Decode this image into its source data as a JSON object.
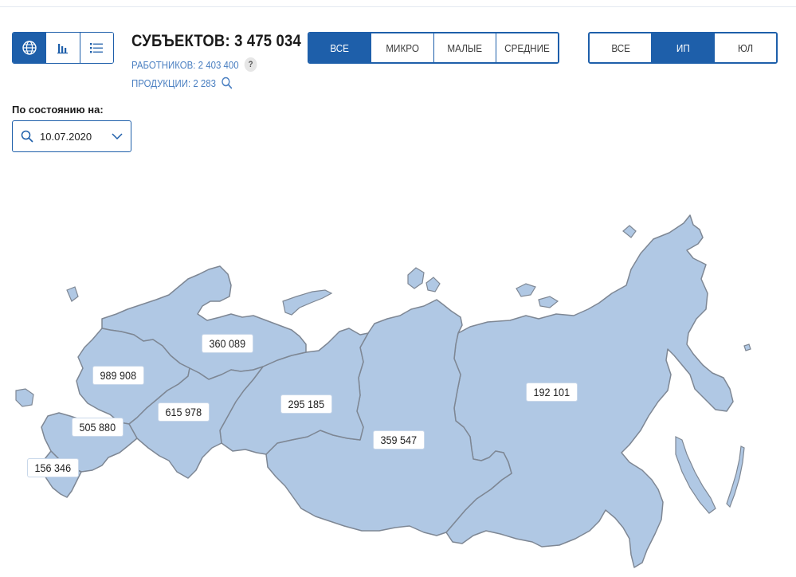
{
  "views": [
    {
      "icon": "globe-icon",
      "active": true
    },
    {
      "icon": "bar-chart-icon",
      "active": false
    },
    {
      "icon": "list-icon",
      "active": false
    }
  ],
  "totals": {
    "subjects_label": "СУБЪЕКТОВ:",
    "subjects_value": "3 475 034",
    "workers_label": "РАБОТНИКОВ:",
    "workers_value": "2 403 400",
    "products_label": "ПРОДУКЦИИ:",
    "products_value": "2 283",
    "help": "?"
  },
  "size_filter": {
    "options": [
      "ВСЕ",
      "МИКРО",
      "МАЛЫЕ",
      "СРЕДНИЕ"
    ],
    "selected": "ВСЕ"
  },
  "type_filter": {
    "options": [
      "ВСЕ",
      "ИП",
      "ЮЛ"
    ],
    "selected": "ИП"
  },
  "date": {
    "label": "По состоянию на:",
    "value": "10.07.2020"
  },
  "regions": [
    {
      "id": "central",
      "value": "989 908"
    },
    {
      "id": "northwest",
      "value": "360 089"
    },
    {
      "id": "south",
      "value": "505 880"
    },
    {
      "id": "north-caucasus",
      "value": "156 346"
    },
    {
      "id": "volga",
      "value": "615 978"
    },
    {
      "id": "ural",
      "value": "295 185"
    },
    {
      "id": "siberia",
      "value": "359 547"
    },
    {
      "id": "far-east",
      "value": "192 101"
    }
  ],
  "colors": {
    "accent": "#1e5faa",
    "map_fill": "#b0c8e4",
    "map_border": "#7e8794",
    "link_text": "#4a7fc1"
  }
}
